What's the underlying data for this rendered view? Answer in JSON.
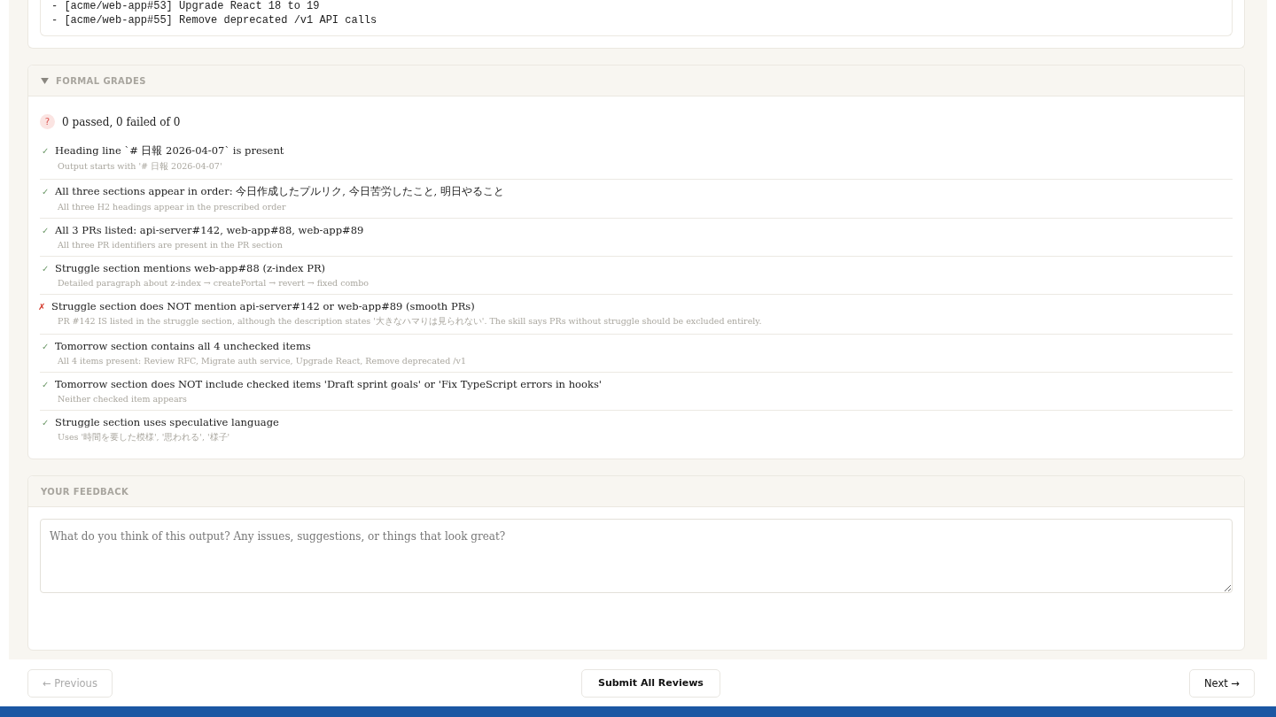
{
  "output_code": {
    "lines": [
      "- [acme/web-app#53] Upgrade React 18 to 19",
      "- [acme/web-app#55] Remove deprecated /v1 API calls"
    ]
  },
  "formal_grades": {
    "title": "FORMAL GRADES",
    "expanded": true,
    "summary": {
      "badge": "?",
      "text": "0 passed, 0 failed of 0"
    },
    "checks": [
      {
        "passed": true,
        "mark": "✓",
        "title": "Heading line `# 日報 2026-04-07` is present",
        "detail": "Output starts with '# 日報 2026-04-07'"
      },
      {
        "passed": true,
        "mark": "✓",
        "title": "All three sections appear in order: 今日作成したプルリク, 今日苦労したこと, 明日やること",
        "detail": "All three H2 headings appear in the prescribed order"
      },
      {
        "passed": true,
        "mark": "✓",
        "title": "All 3 PRs listed: api-server#142, web-app#88, web-app#89",
        "detail": "All three PR identifiers are present in the PR section"
      },
      {
        "passed": true,
        "mark": "✓",
        "title": "Struggle section mentions web-app#88 (z-index PR)",
        "detail": "Detailed paragraph about z-index → createPortal → revert → fixed combo"
      },
      {
        "passed": false,
        "mark": "✗",
        "title": "Struggle section does NOT mention api-server#142 or web-app#89 (smooth PRs)",
        "detail": "PR #142 IS listed in the struggle section, although the description states '大きなハマりは見られない'. The skill says PRs without struggle should be excluded entirely."
      },
      {
        "passed": true,
        "mark": "✓",
        "title": "Tomorrow section contains all 4 unchecked items",
        "detail": "All 4 items present: Review RFC, Migrate auth service, Upgrade React, Remove deprecated /v1"
      },
      {
        "passed": true,
        "mark": "✓",
        "title": "Tomorrow section does NOT include checked items 'Draft sprint goals' or 'Fix TypeScript errors in hooks'",
        "detail": "Neither checked item appears"
      },
      {
        "passed": true,
        "mark": "✓",
        "title": "Struggle section uses speculative language",
        "detail": "Uses '時間を要した模様', '思われる', '様子'"
      }
    ]
  },
  "feedback": {
    "title": "YOUR FEEDBACK",
    "placeholder": "What do you think of this output? Any issues, suggestions, or things that look great?"
  },
  "nav": {
    "previous": {
      "label": "← Previous",
      "disabled": true
    },
    "submit": {
      "label": "Submit All Reviews"
    },
    "next": {
      "label": "Next →",
      "disabled": false
    }
  }
}
